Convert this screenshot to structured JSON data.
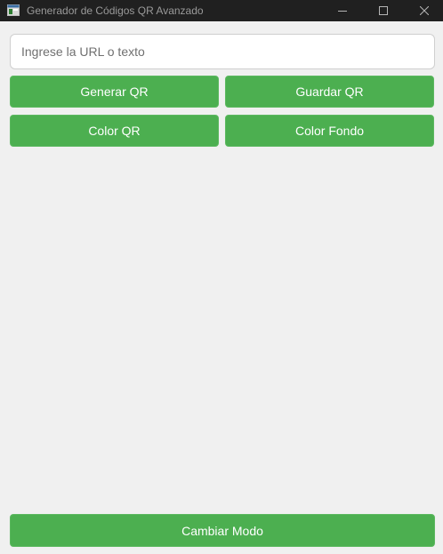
{
  "window": {
    "title": "Generador de Códigos QR Avanzado",
    "icon": "app-window-icon",
    "controls": {
      "minimize_icon": "minimize-icon",
      "maximize_icon": "maximize-icon",
      "close_icon": "close-icon"
    }
  },
  "input": {
    "placeholder": "Ingrese la URL o texto",
    "value": ""
  },
  "buttons": {
    "generate": "Generar QR",
    "save": "Guardar QR",
    "qr_color": "Color QR",
    "background_color": "Color Fondo",
    "toggle_mode": "Cambiar Modo"
  },
  "colors": {
    "accent": "#4caf50",
    "background": "#f0f0f0",
    "titlebar": "#202020"
  }
}
